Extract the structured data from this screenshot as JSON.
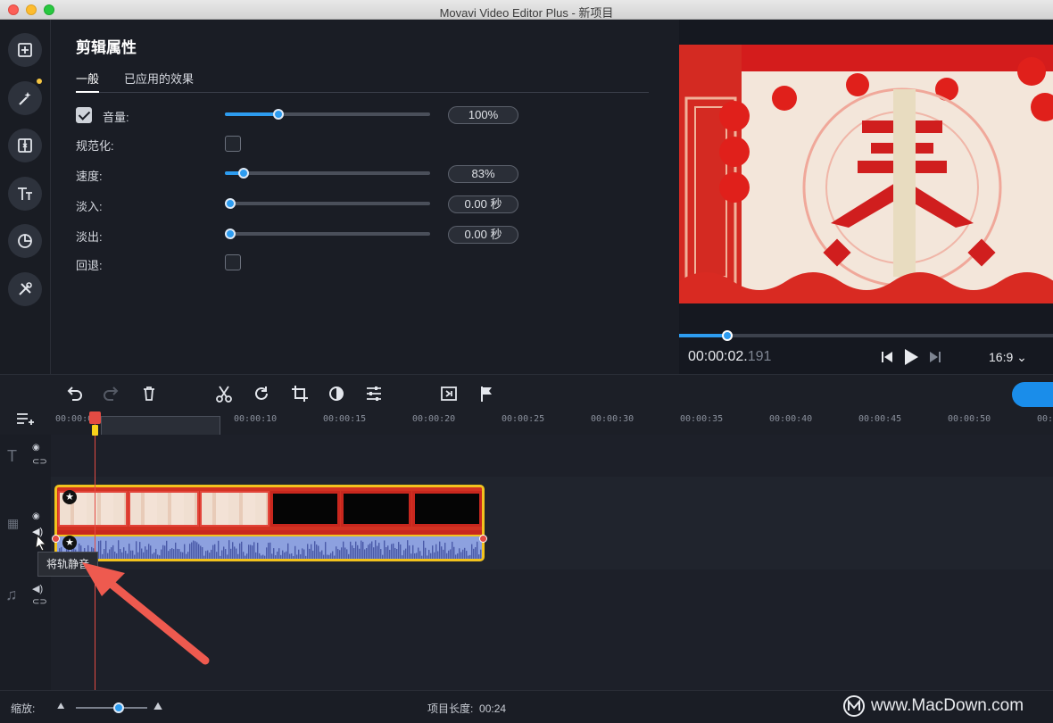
{
  "window": {
    "title": "Movavi Video Editor Plus - 新项目"
  },
  "sidebar": {
    "items": [
      {
        "icon": "import-icon"
      },
      {
        "icon": "magic-wand-icon"
      },
      {
        "icon": "transitions-icon"
      },
      {
        "icon": "titles-icon"
      },
      {
        "icon": "stickers-icon"
      },
      {
        "icon": "tools-icon"
      }
    ]
  },
  "properties": {
    "title": "剪辑属性",
    "tabs": [
      {
        "label": "一般",
        "active": true
      },
      {
        "label": "已应用的效果",
        "active": false
      }
    ],
    "rows": {
      "volume": {
        "label": "音量:",
        "checked": true,
        "value": "100%",
        "level": 0.26
      },
      "normalize": {
        "label": "规范化:",
        "checked": false
      },
      "speed": {
        "label": "速度:",
        "value": "83%",
        "level": 0.09
      },
      "fade_in": {
        "label": "淡入:",
        "value": "0.00 秒",
        "level": 0.0
      },
      "fade_out": {
        "label": "淡出:",
        "value": "0.00 秒",
        "level": 0.0
      },
      "reverse": {
        "label": "回退:",
        "checked": false
      }
    }
  },
  "player": {
    "timecode_main": "00:00:02.",
    "timecode_ms": "191",
    "progress": 0.12,
    "aspect_ratio": "16:9"
  },
  "timeline": {
    "ruler_ticks": [
      "00:00:00",
      "00:00:10",
      "00:00:15",
      "00:00:20",
      "00:00:25",
      "00:00:30",
      "00:00:35",
      "00:00:40",
      "00:00:45",
      "00:00:50",
      "00:0"
    ],
    "tooltip": "将轨静音"
  },
  "bottom": {
    "zoom_label": "缩放:",
    "project_length_label": "项目长度:",
    "project_length": "00:24",
    "watermark": "www.MacDown.com"
  },
  "colors": {
    "accent": "#2d9cf0",
    "clip_border": "#f2c31e",
    "playhead": "#e34b43",
    "audio_wave": "#8da1df"
  }
}
